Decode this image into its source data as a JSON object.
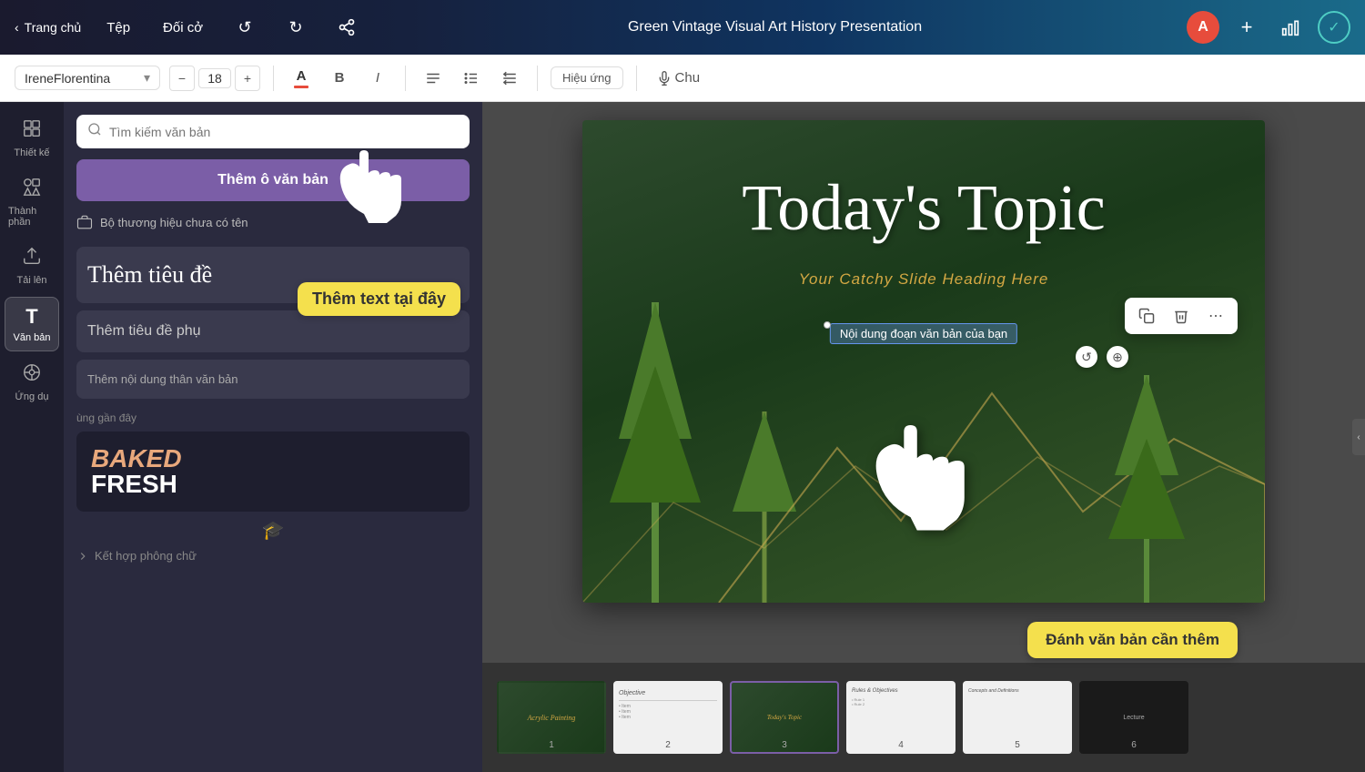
{
  "topNav": {
    "back_label": "Trang chủ",
    "menu_items": [
      "Tệp",
      "Đối cở"
    ],
    "title": "Green Vintage Visual Art History Presentation",
    "avatar_letter": "A",
    "undo_icon": "↺",
    "redo_icon": "↻",
    "share_icon": "⤴"
  },
  "toolbar": {
    "font_name": "IreneFlorentina",
    "font_size": "18",
    "bold_label": "B",
    "italic_label": "I",
    "color_label": "A",
    "align_label": "≡",
    "list_label": "☰",
    "effects_label": "Hiệu ứng",
    "voice_label": "Chu"
  },
  "textPanel": {
    "search_placeholder": "Tìm kiếm văn bản",
    "add_text_box_label": "Thêm ô văn bản",
    "brand_label": "Bộ thương hiệu chưa có tên",
    "add_title_label": "Thêm tiêu đề",
    "add_subtitle_label": "Thêm tiêu đề phụ",
    "add_body_label": "Thêm nội dung thân văn bản",
    "recent_label": "ùng gần đây",
    "baked_label": "BAKED",
    "fresh_label": "FRESH",
    "combine_fonts_label": "Kết hợp phông chữ",
    "sidebar_items": [
      {
        "icon": "⊞",
        "label": "Thiết kế"
      },
      {
        "icon": "◇",
        "label": "Thành phần"
      },
      {
        "icon": "↑",
        "label": "Tải lên"
      },
      {
        "icon": "T",
        "label": "Văn bản"
      },
      {
        "icon": "⊙",
        "label": "Ứng dụ"
      }
    ]
  },
  "slide": {
    "title": "Today's Topic",
    "subtitle": "Your Catchy Slide Heading Here",
    "body_text": "Nội dung đoạn văn bản của bạn",
    "tooltip_add_text": "Thêm text tại đây",
    "tooltip_type_text": "Đánh văn bản cần thêm"
  },
  "thumbnails": [
    {
      "label": "Acrylic Painting",
      "num": "1",
      "type": "green"
    },
    {
      "label": "Objective",
      "num": "2",
      "type": "white"
    },
    {
      "label": "Today's Topic",
      "num": "3",
      "type": "active_green"
    },
    {
      "label": "Rules & Objectives",
      "num": "4",
      "type": "white"
    },
    {
      "label": "Concepts and Definitions",
      "num": "5",
      "type": "white"
    },
    {
      "label": "Lecture",
      "num": "6",
      "type": "dark"
    }
  ],
  "colors": {
    "accent_purple": "#7b5ea7",
    "accent_yellow": "#f4e04d",
    "green_dark": "#2d4a2d",
    "text_selected": "rgba(100,149,237,0.4)"
  }
}
